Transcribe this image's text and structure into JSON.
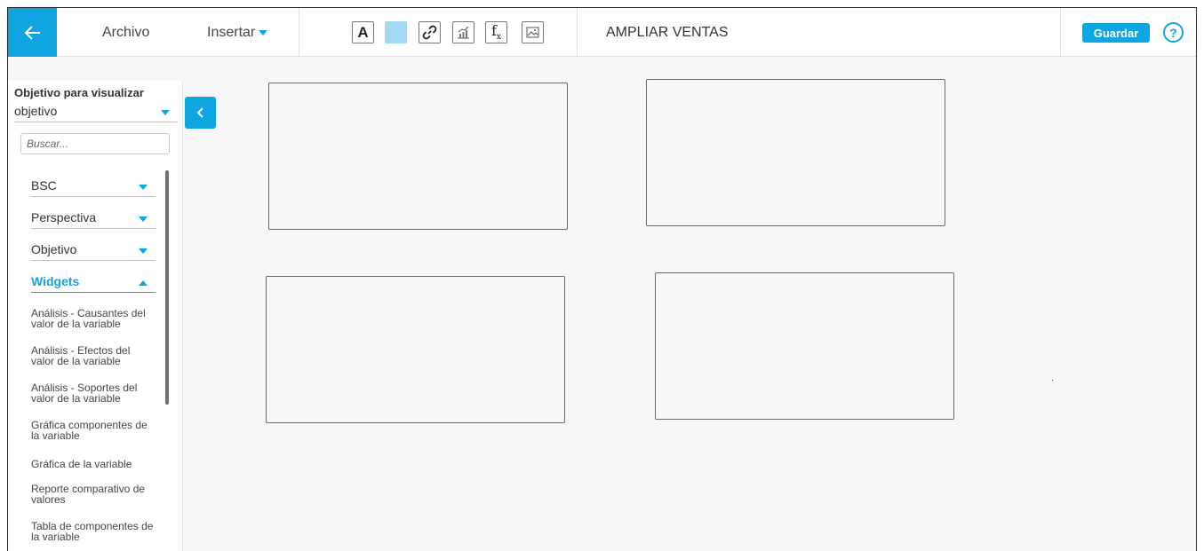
{
  "header": {
    "menu_file": "Archivo",
    "menu_insert": "Insertar",
    "page_title": "AMPLIAR VENTAS",
    "save_label": "Guardar",
    "help_label": "?",
    "tool_text_label": "A",
    "tool_formula_label": "f",
    "tool_formula_sub": "x"
  },
  "sidebar": {
    "title": "Objetivo para visualizar",
    "select_value": "objetivo",
    "search_placeholder": "Buscar...",
    "filters": [
      {
        "label": "BSC"
      },
      {
        "label": "Perspectiva"
      },
      {
        "label": "Objetivo"
      },
      {
        "label": "Widgets"
      }
    ],
    "widgets": [
      {
        "label": "Análisis - Causantes del valor de la variable"
      },
      {
        "label": "Análisis - Efectos del valor de la variable"
      },
      {
        "label": "Análisis - Soportes del valor de la variable"
      },
      {
        "label": "Gráfica componentes de la variable"
      },
      {
        "label": "Gráfica de la variable"
      },
      {
        "label": "Reporte comparativo de valores"
      },
      {
        "label": "Tabla de componentes de la variable"
      }
    ]
  },
  "colors": {
    "accent": "#0fa5e0",
    "color_swatch": "#a2d8f2"
  },
  "icons": [
    "back-arrow-icon",
    "text-icon",
    "color-icon",
    "link-icon",
    "chart-icon",
    "formula-icon",
    "image-icon",
    "help-icon",
    "chevron-left-icon"
  ]
}
